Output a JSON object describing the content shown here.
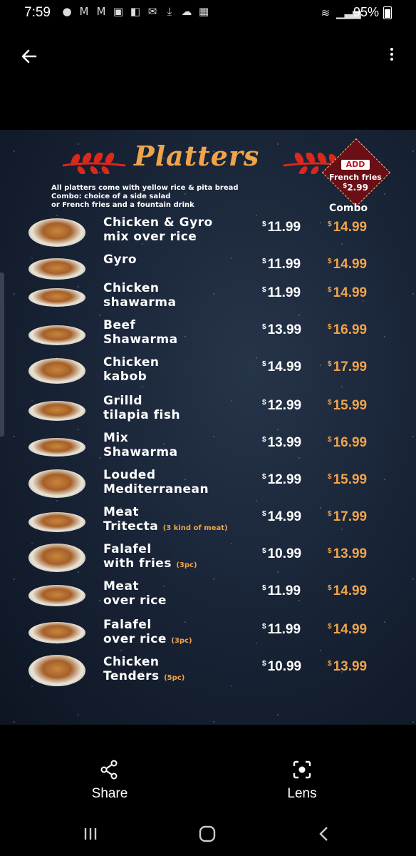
{
  "status": {
    "time": "7:59",
    "battery": "95%",
    "notif_icons": [
      "account-icon",
      "gmail-icon",
      "gmail-icon",
      "app-icon",
      "outlook-icon",
      "mail-icon",
      "download-icon",
      "cloud-icon",
      "calendar-icon"
    ]
  },
  "menu": {
    "title": "Platters",
    "intro_line1": "All platters come with yellow rice & pita bread",
    "intro_combo_label": "Combo:",
    "intro_line2": "choice of a side salad",
    "intro_line3": "or French fries and a fountain drink",
    "combo_header": "Combo",
    "badge": {
      "add": "ADD",
      "item": "French fries",
      "price": "2.99"
    },
    "currency": "$",
    "items": [
      {
        "line1": "Chicken & Gyro",
        "line2": "mix over rice",
        "note": "",
        "price": "11.99",
        "combo": "14.99"
      },
      {
        "line1": "Gyro",
        "line2": "",
        "note": "",
        "price": "11.99",
        "combo": "14.99"
      },
      {
        "line1": "Chicken",
        "line2": "shawarma",
        "note": "",
        "price": "11.99",
        "combo": "14.99"
      },
      {
        "line1": "Beef",
        "line2": "Shawarma",
        "note": "",
        "price": "13.99",
        "combo": "16.99"
      },
      {
        "line1": "Chicken",
        "line2": "kabob",
        "note": "",
        "price": "14.99",
        "combo": "17.99"
      },
      {
        "line1": "Grilld",
        "line2": "tilapia fish",
        "note": "",
        "price": "12.99",
        "combo": "15.99"
      },
      {
        "line1": "Mix",
        "line2": "Shawarma",
        "note": "",
        "price": "13.99",
        "combo": "16.99"
      },
      {
        "line1": "Louded",
        "line2": "Mediterranean",
        "note": "",
        "price": "12.99",
        "combo": "15.99"
      },
      {
        "line1": "Meat",
        "line2": "Tritecta",
        "note": "(3 kind of meat)",
        "price": "14.99",
        "combo": "17.99"
      },
      {
        "line1": "Falafel",
        "line2": "with fries",
        "note": "(3pc)",
        "price": "10.99",
        "combo": "13.99"
      },
      {
        "line1": "Meat",
        "line2": "over rice",
        "note": "",
        "price": "11.99",
        "combo": "14.99"
      },
      {
        "line1": "Falafel",
        "line2": "over rice",
        "note": "(3pc)",
        "price": "11.99",
        "combo": "14.99"
      },
      {
        "line1": "Chicken",
        "line2": "Tenders",
        "note": "(5pc)",
        "price": "10.99",
        "combo": "13.99"
      }
    ]
  },
  "actions": {
    "share": "Share",
    "lens": "Lens"
  },
  "colors": {
    "accent": "#f0a44a",
    "badge": "#6b0f16",
    "laurel": "#d9281c"
  }
}
